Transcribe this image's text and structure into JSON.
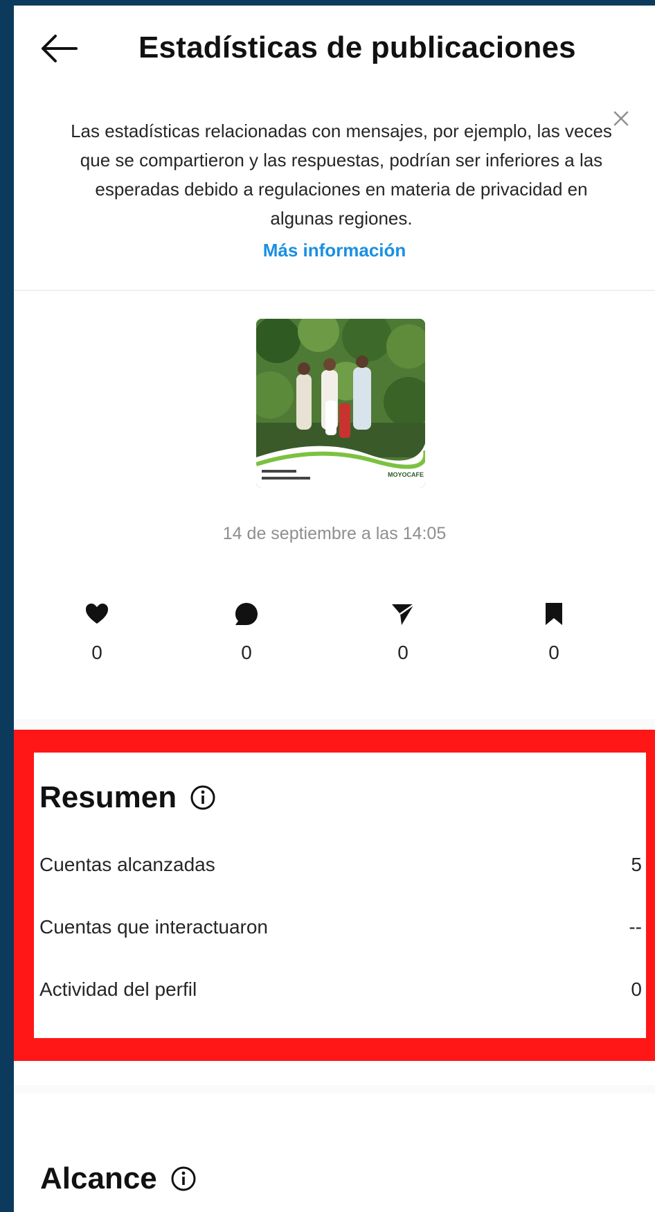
{
  "header": {
    "title": "Estadísticas de publicaciones",
    "back_icon": "arrow-left-icon"
  },
  "notice": {
    "text": "Las estadísticas relacionadas con mensajes, por ejemplo, las veces que se compartieron y las respuestas, podrían ser inferiores a las esperadas debido a regulaciones en materia de privacidad en algunas regiones.",
    "link_label": "Más información",
    "close_icon": "close-icon",
    "link_color": "#1a8fe3"
  },
  "post": {
    "date": "14 de septiembre a las 14:05",
    "thumbnail_brand": "MOYOCAFE",
    "stats": [
      {
        "icon": "heart-icon",
        "value": "0"
      },
      {
        "icon": "comment-icon",
        "value": "0"
      },
      {
        "icon": "share-icon",
        "value": "0"
      },
      {
        "icon": "bookmark-icon",
        "value": "0"
      }
    ]
  },
  "summary": {
    "title": "Resumen",
    "highlight_color": "#ff1616",
    "rows": [
      {
        "label": "Cuentas alcanzadas",
        "value": "5"
      },
      {
        "label": "Cuentas que interactuaron",
        "value": "--"
      },
      {
        "label": "Actividad del perfil",
        "value": "0"
      }
    ]
  },
  "reach": {
    "title": "Alcance"
  }
}
